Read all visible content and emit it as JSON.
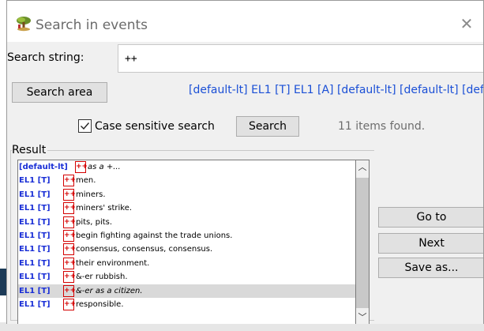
{
  "window": {
    "title": "Search in events",
    "close_glyph": "✕",
    "app_icon": "tree-scene-icon"
  },
  "search": {
    "label": "Search string:",
    "value": "++"
  },
  "area": {
    "button_label": "Search area",
    "value": "[default-lt] EL1 [T] EL1 [A] [default-lt] [default-lt] [def"
  },
  "options": {
    "case_sensitive_label": "Case sensitive search",
    "case_sensitive_checked": true,
    "search_button_label": "Search",
    "status": "11 items found."
  },
  "result": {
    "label": "Result",
    "rows": [
      {
        "tag": "[default-lt]",
        "mark": "++",
        "text": "as a +...",
        "italic": true,
        "selected": false
      },
      {
        "tag": "EL1 [T]",
        "mark": "++",
        "text": "men.",
        "italic": false,
        "selected": false
      },
      {
        "tag": "EL1 [T]",
        "mark": "++",
        "text": "miners.",
        "italic": false,
        "selected": false
      },
      {
        "tag": "EL1 [T]",
        "mark": "++",
        "text": "miners' strike.",
        "italic": false,
        "selected": false
      },
      {
        "tag": "EL1 [T]",
        "mark": "++",
        "text": "pits, pits.",
        "italic": false,
        "selected": false
      },
      {
        "tag": "EL1 [T]",
        "mark": "++",
        "text": "begin fighting against the trade unions.",
        "italic": false,
        "selected": false
      },
      {
        "tag": "EL1 [T]",
        "mark": "++",
        "text": "consensus, consensus, consensus.",
        "italic": false,
        "selected": false
      },
      {
        "tag": "EL1 [T]",
        "mark": "++",
        "text": "their environment.",
        "italic": false,
        "selected": false
      },
      {
        "tag": "EL1 [T]",
        "mark": "++",
        "text": "&-er rubbish.",
        "italic": false,
        "selected": false
      },
      {
        "tag": "EL1 [T]",
        "mark": "++",
        "text": "&-er as a citizen.",
        "italic": true,
        "selected": true
      },
      {
        "tag": "EL1 [T]",
        "mark": "++",
        "text": "responsible.",
        "italic": false,
        "selected": false
      }
    ]
  },
  "scroll": {
    "up_glyph": "︿",
    "down_glyph": "﹀"
  },
  "actions": {
    "goto_label": "Go to",
    "next_label": "Next",
    "save_label": "Save as..."
  },
  "colors": {
    "tag_blue": "#1a2fd6",
    "mark_red": "#d40000",
    "area_blue": "#1a4fd6",
    "selected_row": "#d9d9d9"
  }
}
